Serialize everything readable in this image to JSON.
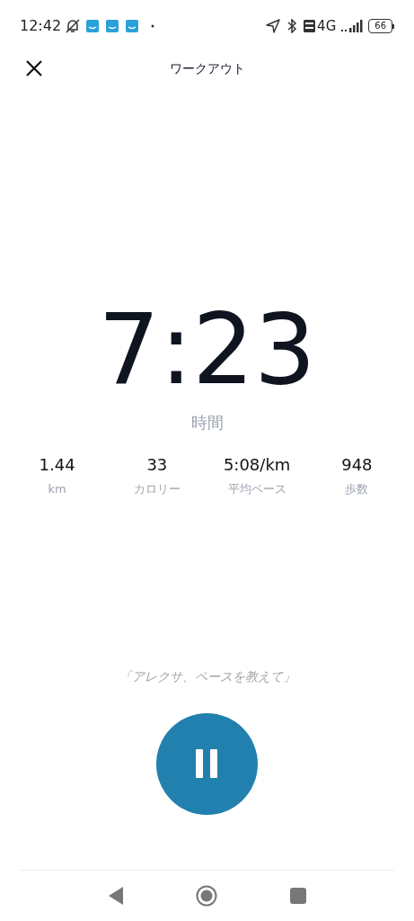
{
  "status_bar": {
    "time": "12:42",
    "network": "4G",
    "battery": "66"
  },
  "header": {
    "title": "ワークアウト"
  },
  "timer": {
    "value": "7:23",
    "label": "時間"
  },
  "stats": [
    {
      "value": "1.44",
      "label": "km"
    },
    {
      "value": "33",
      "label": "カロリー"
    },
    {
      "value": "5:08/km",
      "label": "平均ペース"
    },
    {
      "value": "948",
      "label": "歩数"
    }
  ],
  "hint": "「アレクサ、ペースを教えて」"
}
